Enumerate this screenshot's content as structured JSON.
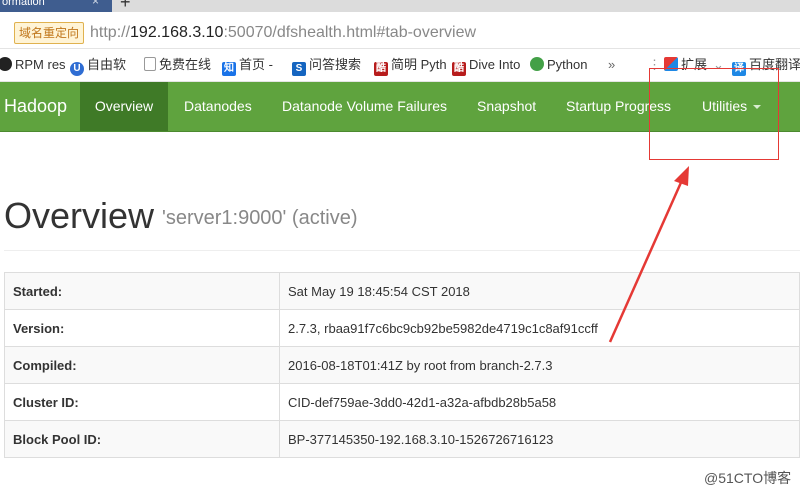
{
  "browser": {
    "tab_title": "ormation",
    "tab_close": "×",
    "new_tab": "+",
    "dns_badge": "域名重定向",
    "url_scheme": "http://",
    "url_host": "192.168.3.10",
    "url_rest": ":50070/dfshealth.html#tab-overview"
  },
  "bookmarks": [
    {
      "label": "RPM res",
      "icon": "tux-icon"
    },
    {
      "label": "自由软",
      "icon": "u-icon"
    },
    {
      "label": "免费在线",
      "icon": "page-icon"
    },
    {
      "label": "首页 -",
      "icon": "zhi-icon",
      "icon_text": "知"
    },
    {
      "label": "问答搜索",
      "icon": "s-icon",
      "icon_text": "S"
    },
    {
      "label": "简明 Pyth",
      "icon": "cu-icon",
      "icon_text": "酷"
    },
    {
      "label": "Dive Into",
      "icon": "cu-icon",
      "icon_text": "酷"
    },
    {
      "label": "Python",
      "icon": "python-icon"
    },
    {
      "label": "»",
      "icon": ""
    },
    {
      "label": "扩展",
      "icon": "extension-icon"
    },
    {
      "label": "百度翻译",
      "icon": "yi-icon",
      "icon_text": "译"
    }
  ],
  "navbar": {
    "brand": "Hadoop",
    "items": [
      "Overview",
      "Datanodes",
      "Datanode Volume Failures",
      "Snapshot",
      "Startup Progress",
      "Utilities"
    ],
    "active": "Overview"
  },
  "header": {
    "title": "Overview",
    "subtitle": "'server1:9000' (active)"
  },
  "info": [
    {
      "key": "Started:",
      "value": "Sat May 19 18:45:54 CST 2018"
    },
    {
      "key": "Version:",
      "value": "2.7.3, rbaa91f7c6bc9cb92be5982de4719c1c8af91ccff"
    },
    {
      "key": "Compiled:",
      "value": "2016-08-18T01:41Z by root from branch-2.7.3"
    },
    {
      "key": "Cluster ID:",
      "value": "CID-def759ae-3dd0-42d1-a32a-afbdb28b5a58"
    },
    {
      "key": "Block Pool ID:",
      "value": "BP-377145350-192.168.3.10-1526726716123"
    }
  ],
  "watermark": "@51CTO博客",
  "colors": {
    "navbar": "#5fa33e",
    "navbar_active": "#3f7a27",
    "annotation": "#e53935"
  }
}
